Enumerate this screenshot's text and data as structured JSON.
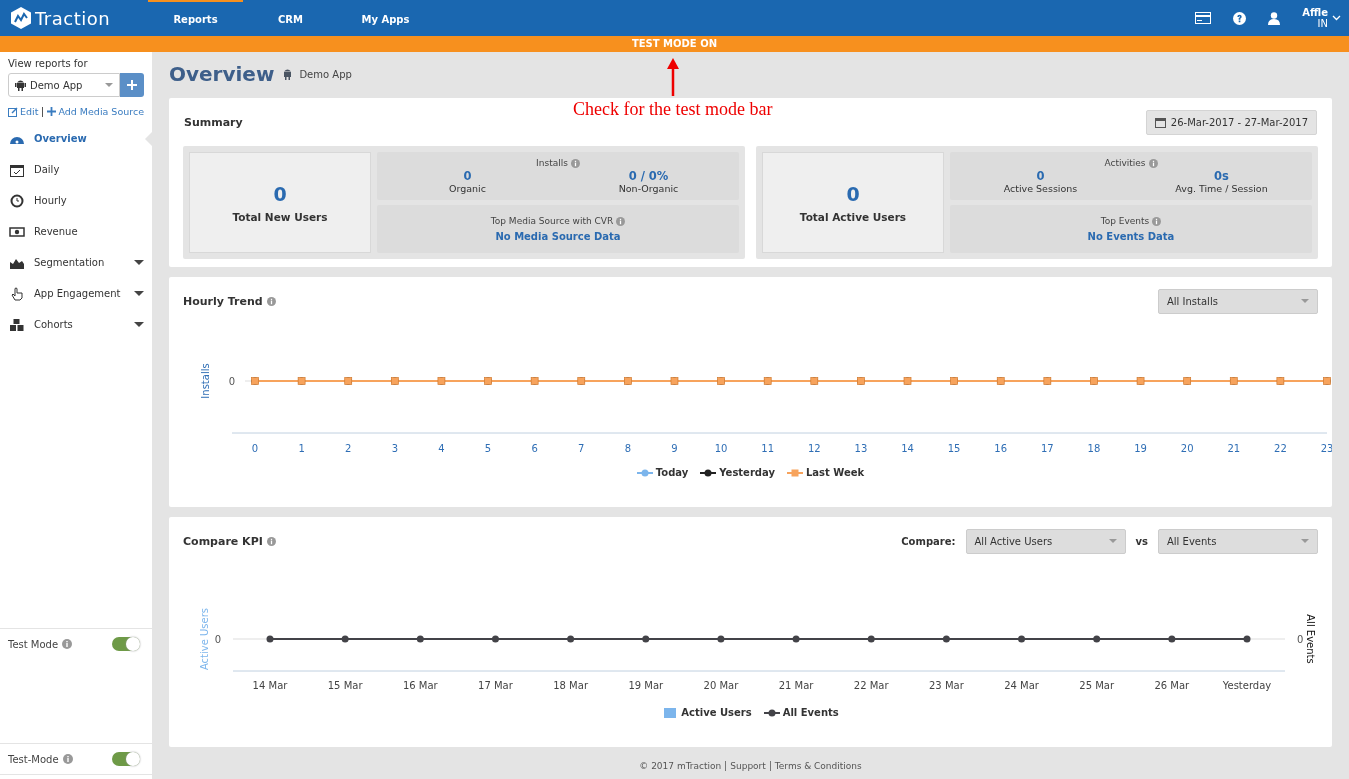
{
  "topbar": {
    "logo": "Traction",
    "nav": [
      {
        "label": "Reports",
        "selected": true
      },
      {
        "label": "CRM",
        "selected": false
      },
      {
        "label": "My Apps",
        "selected": false
      }
    ],
    "user": {
      "name": "Affle",
      "region": "IN"
    }
  },
  "test_mode_bar": {
    "label": "TEST MODE ON"
  },
  "annotation": {
    "text": "Check for the test mode bar"
  },
  "sidebar": {
    "view_label": "View reports for",
    "app_select": "Demo App",
    "edit_link": "Edit",
    "add_link": "Add Media Source",
    "items": [
      {
        "label": "Overview",
        "selected": true,
        "expandable": false
      },
      {
        "label": "Daily",
        "selected": false,
        "expandable": false
      },
      {
        "label": "Hourly",
        "selected": false,
        "expandable": false
      },
      {
        "label": "Revenue",
        "selected": false,
        "expandable": false
      },
      {
        "label": "Segmentation",
        "selected": false,
        "expandable": true
      },
      {
        "label": "App Engagement",
        "selected": false,
        "expandable": true
      },
      {
        "label": "Cohorts",
        "selected": false,
        "expandable": true
      }
    ],
    "toggles": [
      {
        "label": "Test Mode",
        "on": true
      },
      {
        "label": "Test-Mode",
        "on": true
      }
    ]
  },
  "page": {
    "title": "Overview",
    "app": "Demo App"
  },
  "summary": {
    "title": "Summary",
    "date_range": "26-Mar-2017 - 27-Mar-2017",
    "groups": [
      {
        "total_value": "0",
        "total_label": "Total New Users",
        "top_title": "Installs",
        "metrics": [
          {
            "value": "0",
            "label": "Organic"
          },
          {
            "value": "0 / 0%",
            "label": "Non-Organic"
          }
        ],
        "bottom_title": "Top Media Source with CVR",
        "bottom_value": "No Media Source Data"
      },
      {
        "total_value": "0",
        "total_label": "Total Active Users",
        "top_title": "Activities",
        "metrics": [
          {
            "value": "0",
            "label": "Active Sessions"
          },
          {
            "value": "0s",
            "label": "Avg. Time / Session"
          }
        ],
        "bottom_title": "Top Events",
        "bottom_value": "No Events Data"
      }
    ]
  },
  "hourly_trend": {
    "title": "Hourly Trend",
    "filter": "All Installs",
    "y_title": "Installs",
    "y_tick": "0",
    "x_labels": [
      "0",
      "1",
      "2",
      "3",
      "4",
      "5",
      "6",
      "7",
      "8",
      "9",
      "10",
      "11",
      "12",
      "13",
      "14",
      "15",
      "16",
      "17",
      "18",
      "19",
      "20",
      "21",
      "22",
      "23"
    ],
    "legend": [
      {
        "name": "Today",
        "color": "#7cb5ec",
        "kind": "circle"
      },
      {
        "name": "Yesterday",
        "color": "#222222",
        "kind": "circle"
      },
      {
        "name": "Last Week",
        "color": "#f7a35c",
        "kind": "square"
      }
    ]
  },
  "compare_kpi": {
    "title": "Compare KPI",
    "compare_label": "Compare:",
    "first": "All Active Users",
    "vs": "vs",
    "second": "All Events",
    "y_title": "Active Users",
    "y2_title": "All Events",
    "y_tick": "0",
    "y2_tick": "0",
    "x_labels": [
      "14 Mar",
      "15 Mar",
      "16 Mar",
      "17 Mar",
      "18 Mar",
      "19 Mar",
      "20 Mar",
      "21 Mar",
      "22 Mar",
      "23 Mar",
      "24 Mar",
      "25 Mar",
      "26 Mar",
      "Yesterday"
    ],
    "legend": [
      {
        "name": "Active Users",
        "color": "#7cb5ec",
        "kind": "bar"
      },
      {
        "name": "All Events",
        "color": "#434348",
        "kind": "line"
      }
    ]
  },
  "footer": {
    "copyright": "© 2017 mTraction",
    "links": [
      "Support",
      "Terms & Conditions"
    ]
  }
}
